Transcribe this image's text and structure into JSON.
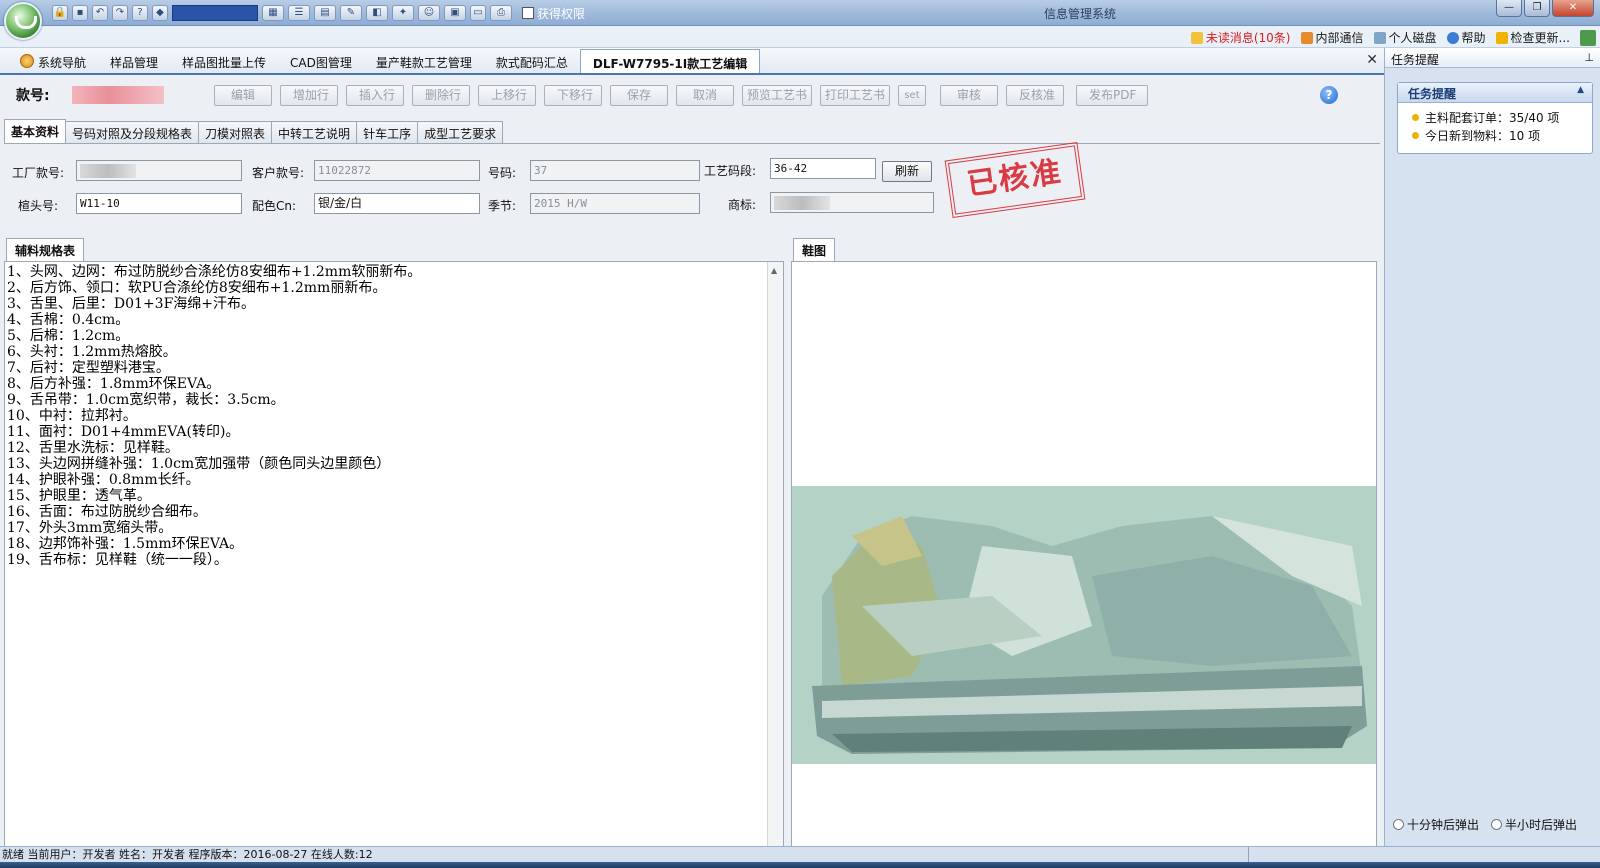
{
  "titlebar": {
    "window_title": "信息管理系统",
    "permission_label": "获得权限",
    "quick_access": [
      "lock-icon",
      "save-icon",
      "undo-icon",
      "redo-icon",
      "help-icon",
      "palette-icon"
    ]
  },
  "toplinks": {
    "unread": "未读消息(10条)",
    "internal": "内部通信",
    "disk": "个人磁盘",
    "help": "帮助",
    "update": "检查更新..."
  },
  "module_tabs": [
    "系统导航",
    "样品管理",
    "样品图批量上传",
    "CAD图管理",
    "量产鞋款工艺管理",
    "款式配码汇总",
    "DLF-W7795-1I款工艺编辑"
  ],
  "editor": {
    "style_label": "款号:",
    "buttons": [
      "编辑",
      "增加行",
      "插入行",
      "删除行",
      "上移行",
      "下移行",
      "保存",
      "取消",
      "预览工艺书",
      "打印工艺书",
      "set",
      "审核",
      "反核准",
      "发布PDF"
    ],
    "subtabs": [
      "基本资料",
      "号码对照及分段规格表",
      "刀模对照表",
      "中转工艺说明",
      "针车工序",
      "成型工艺要求"
    ],
    "form": {
      "factory_no_label": "工厂款号:",
      "customer_no_label": "客户款号:",
      "customer_no": "11022872",
      "size_label": "号码:",
      "size": "37",
      "range_label": "工艺码段:",
      "range": "36-42",
      "refresh": "刷新",
      "last_label": "楦头号:",
      "last": "W11-10",
      "color_label": "配色Cn:",
      "color": "银/金/白",
      "season_label": "季节:",
      "season": "2015 H/W",
      "brand_label": "商标:"
    },
    "stamp": "已核准",
    "left_tab": "辅料规格表",
    "right_tab": "鞋图",
    "spec_lines": [
      "1、头网、边网：布过防脱纱合涤纶仿8安细布+1.2mm软丽新布。",
      "2、后方饰、领口：软PU合涤纶仿8安细布+1.2mm丽新布。",
      "3、舌里、后里：D01+3F海绵+汗布。",
      "4、舌棉：0.4cm。",
      "5、后棉：1.2cm。",
      "6、头衬：1.2mm热熔胶。",
      "7、后衬：定型塑料港宝。",
      "8、后方补强：1.8mm环保EVA。",
      "9、舌吊带：1.0cm宽织带，裁长：3.5cm。",
      "10、中衬：拉邦衬。",
      "11、面衬：D01+4mmEVA(转印)。",
      "12、舌里水洗标：见样鞋。",
      "13、头边网拼缝补强：1.0cm宽加强带（颜色同头边里颜色）",
      "14、护眼补强：0.8mm长纤。",
      "15、护眼里：透气革。",
      "16、舌面：布过防脱纱合细布。",
      "17、外头3mm宽缩头带。",
      "18、边邦饰补强：1.5mm环保EVA。",
      "19、舌布标：见样鞋（统一一段）。"
    ]
  },
  "sidebar": {
    "header": "任务提醒",
    "reminder_title": "任务提醒",
    "items": [
      "主料配套订单：35/40 项",
      "今日新到物料：10 项"
    ],
    "opt1": "十分钟后弹出",
    "opt2": "半小时后弹出"
  },
  "statusbar": {
    "text": "就绪 当前用户：开发者 姓名：开发者 程序版本：2016-08-27 在线人数:12"
  },
  "colors": {
    "accent": "#4a76b8",
    "stamp": "#d8232a",
    "alert": "#d42020"
  }
}
